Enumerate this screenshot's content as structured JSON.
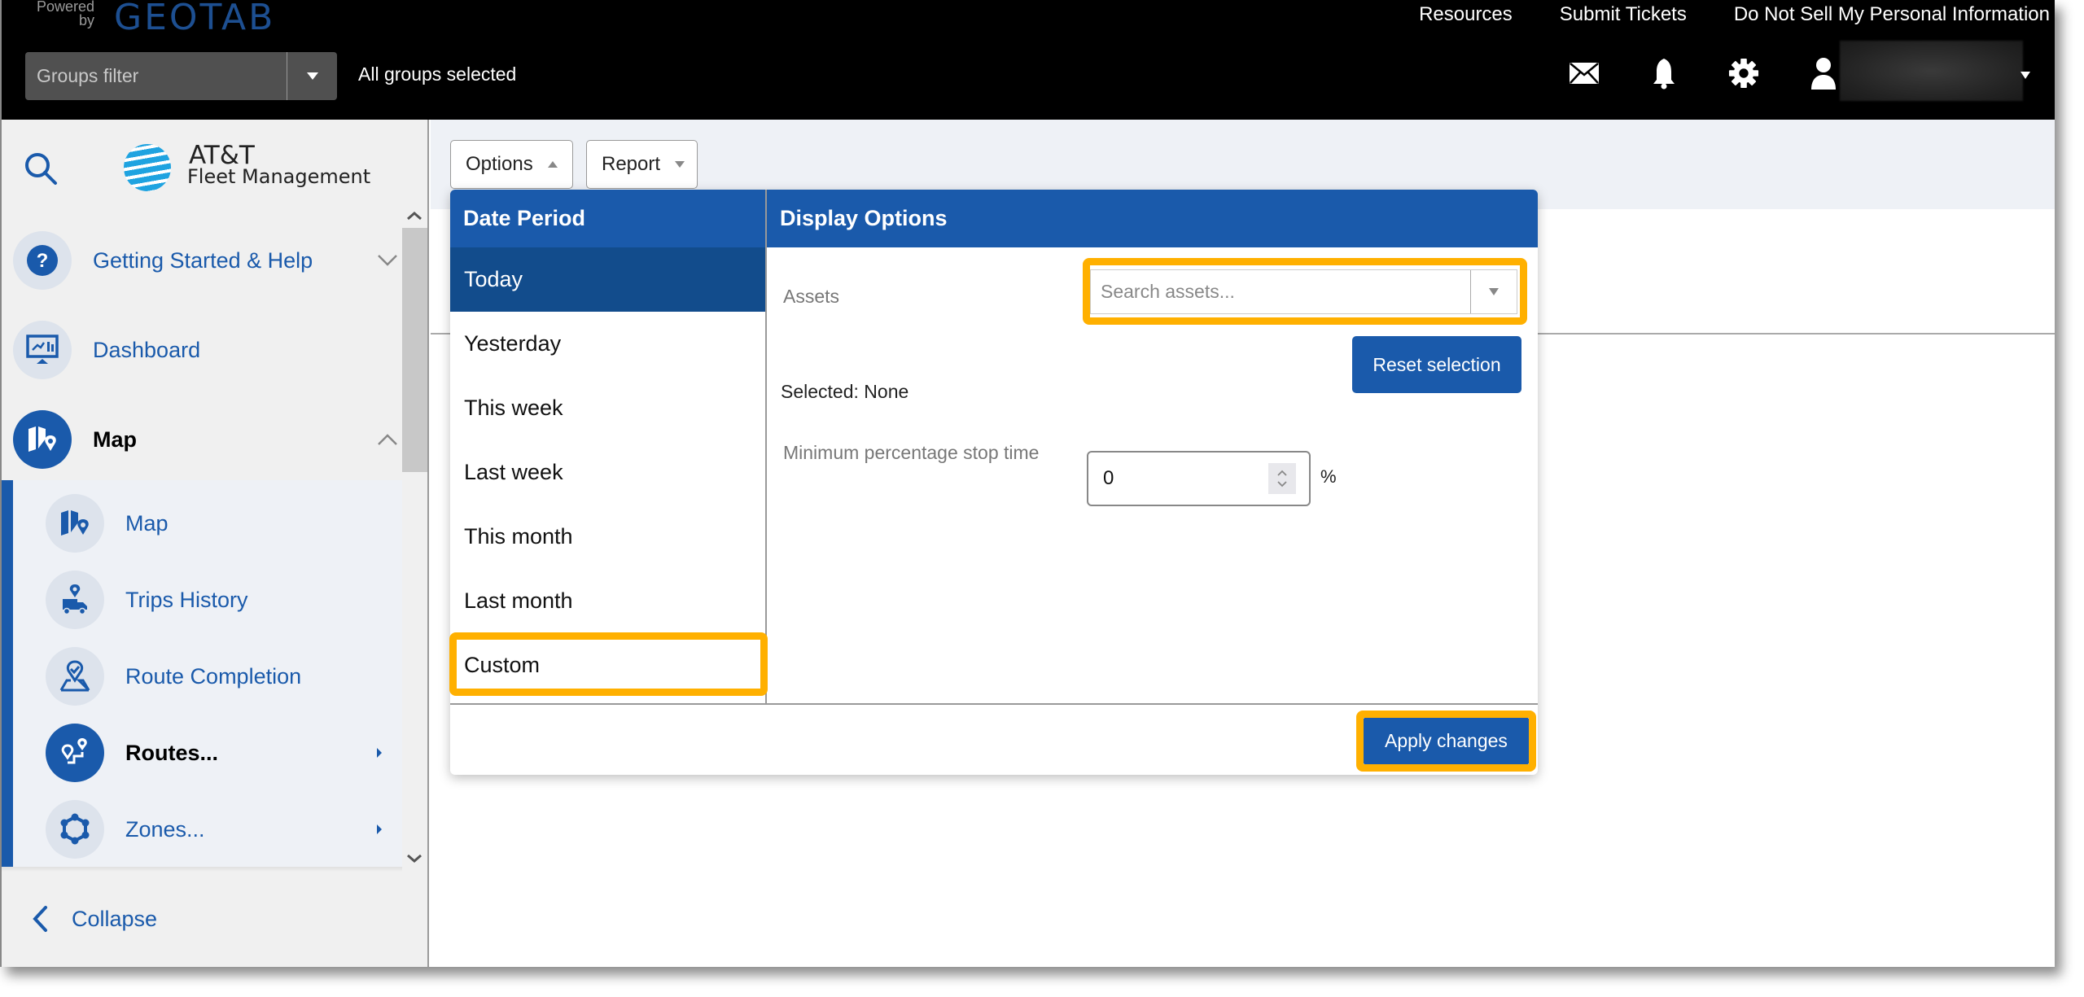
{
  "header": {
    "powered_by": "Powered by",
    "brand": "GEOTAB",
    "groups_filter_label": "Groups filter",
    "groups_status": "All groups selected",
    "links": [
      "Resources",
      "Submit Tickets",
      "Do Not Sell My Personal Information"
    ],
    "icons": [
      "mail-icon",
      "bell-icon",
      "gear-icon",
      "user-icon"
    ]
  },
  "sidebar": {
    "logo_line1": "AT&T",
    "logo_line2": "Fleet Management",
    "items": [
      {
        "label": "Getting Started & Help",
        "icon": "help-icon",
        "chevron": "down"
      },
      {
        "label": "Dashboard",
        "icon": "dashboard-icon"
      },
      {
        "label": "Map",
        "icon": "map-icon",
        "chevron": "up",
        "active": true
      }
    ],
    "subitems": [
      {
        "label": "Map",
        "icon": "map-icon"
      },
      {
        "label": "Trips History",
        "icon": "trips-history-icon"
      },
      {
        "label": "Route Completion",
        "icon": "route-completion-icon"
      },
      {
        "label": "Routes...",
        "icon": "routes-icon",
        "active": true,
        "submenu": true
      },
      {
        "label": "Zones...",
        "icon": "zones-icon",
        "submenu": true
      }
    ],
    "collapse_label": "Collapse"
  },
  "toolbar": {
    "options_label": "Options",
    "report_label": "Report"
  },
  "dialog": {
    "date_period": {
      "title": "Date Period",
      "options": [
        "Today",
        "Yesterday",
        "This week",
        "Last week",
        "This month",
        "Last month",
        "Custom"
      ],
      "selected": "Today",
      "highlighted": "Custom"
    },
    "display_options": {
      "title": "Display Options",
      "assets_label": "Assets",
      "assets_placeholder": "Search assets...",
      "reset_label": "Reset selection",
      "selected_text": "Selected: None",
      "min_stop_label": "Minimum percentage stop time",
      "min_stop_value": "0",
      "min_stop_unit": "%"
    },
    "apply_label": "Apply changes"
  },
  "colors": {
    "brand_blue": "#1a5aab",
    "selected_blue": "#124c8c",
    "highlight_orange": "#ffb000",
    "header_black": "#000000"
  }
}
